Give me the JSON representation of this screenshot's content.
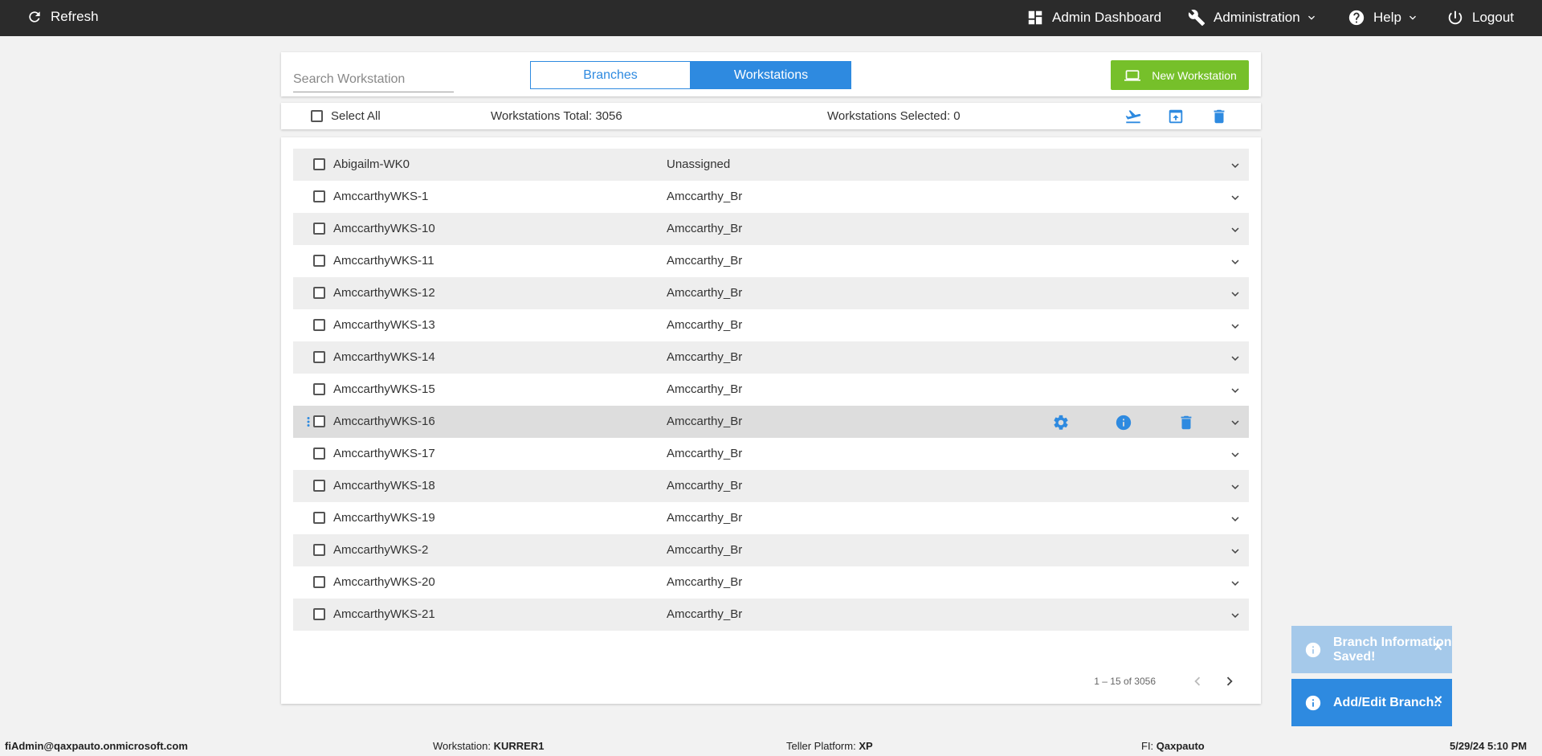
{
  "topbar": {
    "refresh": "Refresh",
    "admin_dashboard": "Admin Dashboard",
    "administration": "Administration",
    "help": "Help",
    "logout": "Logout"
  },
  "header": {
    "search_placeholder": "Search Workstation",
    "tabs": [
      {
        "label": "Branches",
        "active": false
      },
      {
        "label": "Workstations",
        "active": true
      }
    ],
    "new_button": "New Workstation"
  },
  "toolbar": {
    "select_all": "Select All",
    "total": "Workstations Total: 3056",
    "selected": "Workstations Selected: 0"
  },
  "rows": [
    {
      "name": "Abigailm-WK0",
      "branch": "Unassigned"
    },
    {
      "name": "AmccarthyWKS-1",
      "branch": "Amccarthy_Br"
    },
    {
      "name": "AmccarthyWKS-10",
      "branch": "Amccarthy_Br"
    },
    {
      "name": "AmccarthyWKS-11",
      "branch": "Amccarthy_Br"
    },
    {
      "name": "AmccarthyWKS-12",
      "branch": "Amccarthy_Br"
    },
    {
      "name": "AmccarthyWKS-13",
      "branch": "Amccarthy_Br"
    },
    {
      "name": "AmccarthyWKS-14",
      "branch": "Amccarthy_Br"
    },
    {
      "name": "AmccarthyWKS-15",
      "branch": "Amccarthy_Br"
    },
    {
      "name": "AmccarthyWKS-16",
      "branch": "Amccarthy_Br"
    },
    {
      "name": "AmccarthyWKS-17",
      "branch": "Amccarthy_Br"
    },
    {
      "name": "AmccarthyWKS-18",
      "branch": "Amccarthy_Br"
    },
    {
      "name": "AmccarthyWKS-19",
      "branch": "Amccarthy_Br"
    },
    {
      "name": "AmccarthyWKS-2",
      "branch": "Amccarthy_Br"
    },
    {
      "name": "AmccarthyWKS-20",
      "branch": "Amccarthy_Br"
    },
    {
      "name": "AmccarthyWKS-21",
      "branch": "Amccarthy_Br"
    }
  ],
  "pager": "1 – 15 of 3056",
  "toasts": [
    {
      "text": "Branch Information Saved!",
      "close": "×"
    },
    {
      "text": "Add/Edit Branch..",
      "close": "×"
    }
  ],
  "footer": {
    "user": "fiAdmin@qaxpauto.onmicrosoft.com",
    "workstation_label": "Workstation: ",
    "workstation": "KURRER1",
    "platform_label": "Teller Platform: ",
    "platform": "XP",
    "fi_label": "FI: ",
    "fi": "Qaxpauto",
    "datetime": "5/29/24 5:10 PM"
  },
  "colors": {
    "accent": "#2e8ae0",
    "new_button": "#76c02a",
    "topbar": "#2b2b2b"
  }
}
